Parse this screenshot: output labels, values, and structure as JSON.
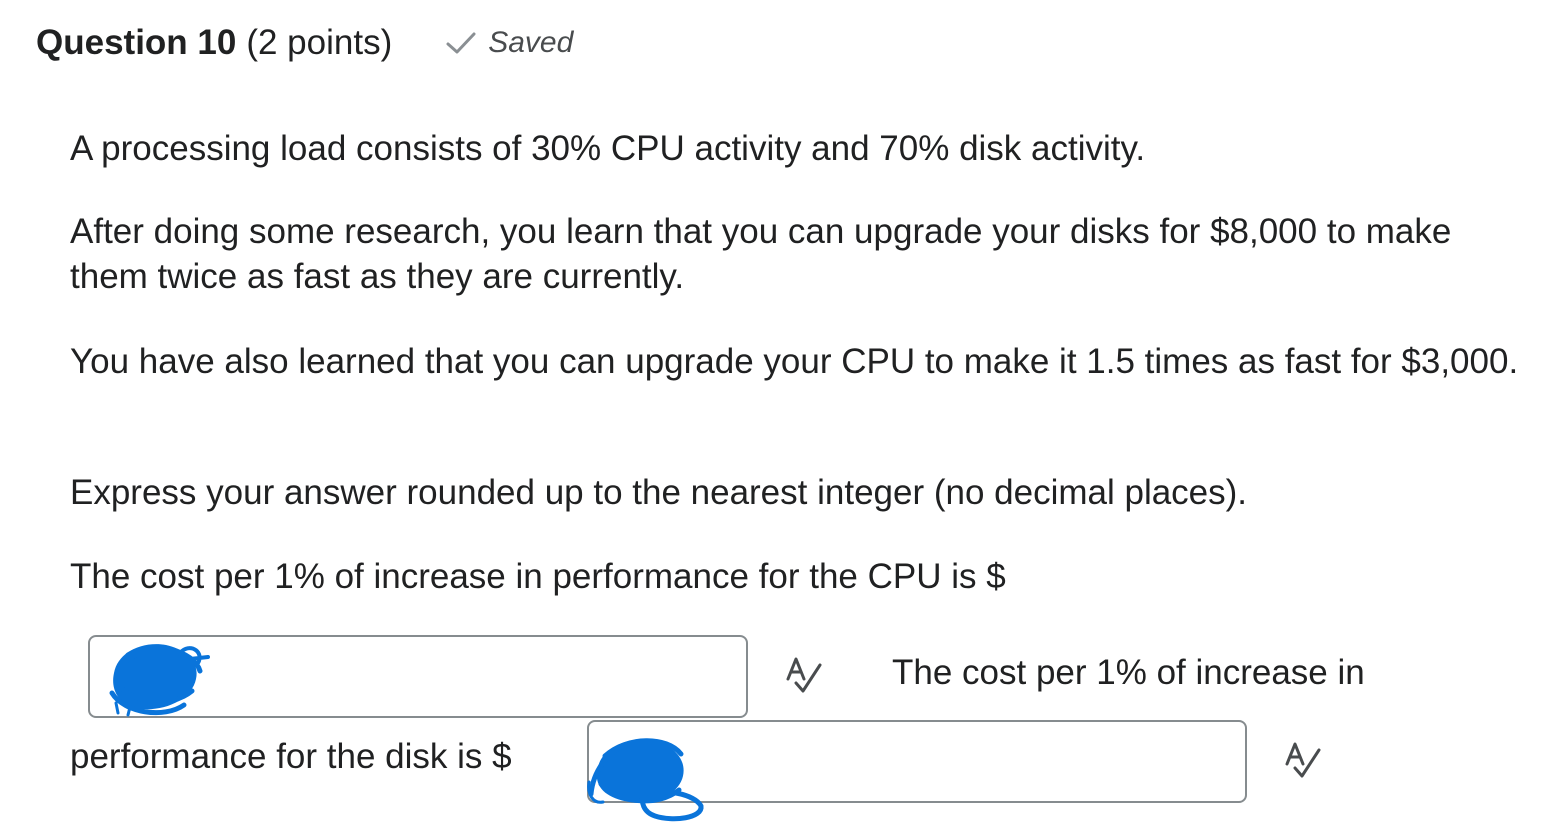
{
  "question": {
    "title": "Question 10",
    "points": "(2 points)",
    "status": {
      "icon": "check-icon",
      "label": "Saved"
    }
  },
  "body": {
    "paragraphs": [
      "A processing load consists of 30% CPU activity and 70% disk activity.",
      "After doing some research, you learn that you can upgrade your disks for $8,000 to make them twice as fast as they are currently.",
      "You have also learned that you can upgrade your CPU to make it 1.5 times as fast for $3,000.",
      "Express your answer rounded up to the nearest integer (no decimal places).",
      "The cost per 1% of increase in performance for the CPU is $"
    ],
    "disk_prompt_part1": "The cost per 1% of increase in",
    "disk_prompt_part2": "performance for the disk is $"
  },
  "answers": {
    "cpu_value": "",
    "disk_value": "",
    "spell_icon": "spell-check-icon"
  },
  "colors": {
    "redaction": "#0a74da",
    "input_border": "#868c8f",
    "text": "#202122",
    "muted": "#494c4e"
  }
}
